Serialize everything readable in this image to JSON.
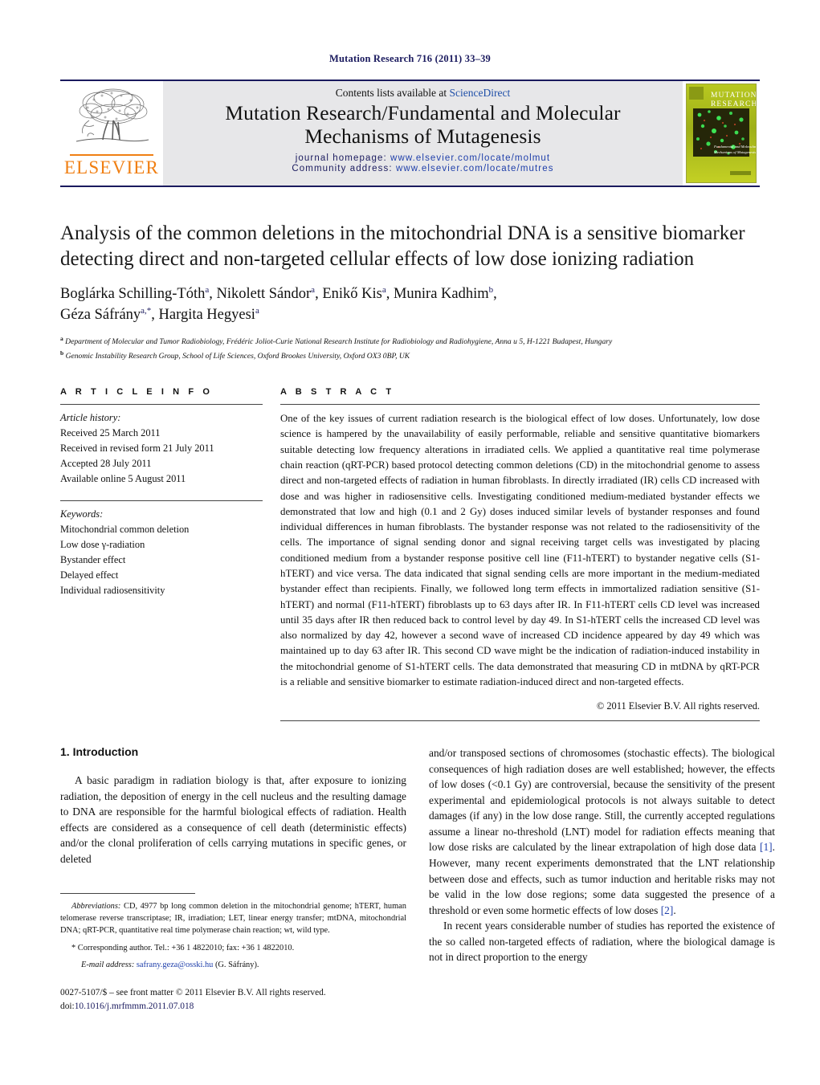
{
  "running_head": "Mutation Research 716 (2011) 33–39",
  "masthead": {
    "publisher_name": "ELSEVIER",
    "contents_prefix": "Contents lists available at ",
    "contents_link": "ScienceDirect",
    "journal_title_line1": "Mutation Research/Fundamental and Molecular",
    "journal_title_line2": "Mechanisms of Mutagenesis",
    "homepage_label": "journal homepage:",
    "homepage_url": "www.elsevier.com/locate/molmut",
    "community_label": "Community address:",
    "community_url": "www.elsevier.com/locate/mutres",
    "cover_title_line1": "MUTATION",
    "cover_title_line2": "RESEARCH",
    "cover_subtitle_line1": "Fundamental and Molecular",
    "cover_subtitle_line2": "Mechanisms of Mutagenesis"
  },
  "article": {
    "title": "Analysis of the common deletions in the mitochondrial DNA is a sensitive biomarker detecting direct and non-targeted cellular effects of low dose ionizing radiation",
    "authors_line1": "Boglárka Schilling-Tóth",
    "authors": [
      {
        "name": "Boglárka Schilling-Tóth",
        "sup": "a"
      },
      {
        "name": "Nikolett Sándor",
        "sup": "a"
      },
      {
        "name": "Enikő Kis",
        "sup": "a"
      },
      {
        "name": "Munira Kadhim",
        "sup": "b"
      },
      {
        "name": "Géza Sáfrány",
        "sup": "a,*"
      },
      {
        "name": "Hargita Hegyesi",
        "sup": "a"
      }
    ],
    "affiliations": [
      {
        "marker": "a",
        "text": "Department of Molecular and Tumor Radiobiology, Frédéric Joliot-Curie National Research Institute for Radiobiology and Radiohygiene, Anna u 5, H-1221 Budapest, Hungary"
      },
      {
        "marker": "b",
        "text": "Genomic Instability Research Group, School of Life Sciences, Oxford Brookes University, Oxford OX3 0BP, UK"
      }
    ]
  },
  "article_info": {
    "heading": "A R T I C L E   I N F O",
    "history_label": "Article history:",
    "history": [
      "Received 25 March 2011",
      "Received in revised form 21 July 2011",
      "Accepted 28 July 2011",
      "Available online 5 August 2011"
    ],
    "keywords_label": "Keywords:",
    "keywords": [
      "Mitochondrial common deletion",
      "Low dose γ-radiation",
      "Bystander effect",
      "Delayed effect",
      "Individual radiosensitivity"
    ]
  },
  "abstract": {
    "heading": "A B S T R A C T",
    "text": "One of the key issues of current radiation research is the biological effect of low doses. Unfortunately, low dose science is hampered by the unavailability of easily performable, reliable and sensitive quantitative biomarkers suitable detecting low frequency alterations in irradiated cells. We applied a quantitative real time polymerase chain reaction (qRT-PCR) based protocol detecting common deletions (CD) in the mitochondrial genome to assess direct and non-targeted effects of radiation in human fibroblasts. In directly irradiated (IR) cells CD increased with dose and was higher in radiosensitive cells. Investigating conditioned medium-mediated bystander effects we demonstrated that low and high (0.1 and 2 Gy) doses induced similar levels of bystander responses and found individual differences in human fibroblasts. The bystander response was not related to the radiosensitivity of the cells. The importance of signal sending donor and signal receiving target cells was investigated by placing conditioned medium from a bystander response positive cell line (F11-hTERT) to bystander negative cells (S1-hTERT) and vice versa. The data indicated that signal sending cells are more important in the medium-mediated bystander effect than recipients. Finally, we followed long term effects in immortalized radiation sensitive (S1-hTERT) and normal (F11-hTERT) fibroblasts up to 63 days after IR. In F11-hTERT cells CD level was increased until 35 days after IR then reduced back to control level by day 49. In S1-hTERT cells the increased CD level was also normalized by day 42, however a second wave of increased CD incidence appeared by day 49 which was maintained up to day 63 after IR. This second CD wave might be the indication of radiation-induced instability in the mitochondrial genome of S1-hTERT cells. The data demonstrated that measuring CD in mtDNA by qRT-PCR is a reliable and sensitive biomarker to estimate radiation-induced direct and non-targeted effects.",
    "copyright": "© 2011 Elsevier B.V. All rights reserved."
  },
  "introduction": {
    "heading": "1. Introduction",
    "left_paragraph": "A basic paradigm in radiation biology is that, after exposure to ionizing radiation, the deposition of energy in the cell nucleus and the resulting damage to DNA are responsible for the harmful biological effects of radiation. Health effects are considered as a consequence of cell death (deterministic effects) and/or the clonal proliferation of cells carrying mutations in specific genes, or deleted",
    "right_paragraph_1a": "and/or transposed sections of chromosomes (stochastic effects). The biological consequences of high radiation doses are well established; however, the effects of low doses (<0.1 Gy) are controversial, because the sensitivity of the present experimental and epidemiological protocols is not always suitable to detect damages (if any) in the low dose range. Still, the currently accepted regulations assume a linear no-threshold (LNT) model for radiation effects meaning that low dose risks are calculated by the linear extrapolation of high dose data ",
    "ref1": "[1]",
    "right_paragraph_1b": ". However, many recent experiments demonstrated that the LNT relationship between dose and effects, such as tumor induction and heritable risks may not be valid in the low dose regions; some data suggested the presence of a threshold or even some hormetic effects of low doses ",
    "ref2": "[2]",
    "right_paragraph_1c": ".",
    "right_paragraph_2": "In recent years considerable number of studies has reported the existence of the so called non-targeted effects of radiation, where the biological damage is not in direct proportion to the energy"
  },
  "footnotes": {
    "abbreviations_label": "Abbreviations:",
    "abbreviations_text": " CD, 4977 bp long common deletion in the mitochondrial genome; hTERT, human telomerase reverse transcriptase; IR, irradiation; LET, linear energy transfer; mtDNA, mitochondrial DNA; qRT-PCR, quantitative real time polymerase chain reaction; wt, wild type.",
    "corresponding": "* Corresponding author. Tel.: +36 1 4822010; fax: +36 1 4822010.",
    "email_label": "E-mail address:",
    "email": "safrany.geza@osski.hu",
    "email_owner": "(G. Sáfrány)."
  },
  "imprint": {
    "issn_line": "0027-5107/$ – see front matter © 2011 Elsevier B.V. All rights reserved.",
    "doi_prefix": "doi:",
    "doi": "10.1016/j.mrfmmm.2011.07.018"
  },
  "colors": {
    "navy": "#1a1a5e",
    "link_blue": "#1f3faa",
    "elsevier_orange": "#f07f13",
    "band_gray": "#e7e7e9",
    "cover_green": "#a8b820"
  }
}
